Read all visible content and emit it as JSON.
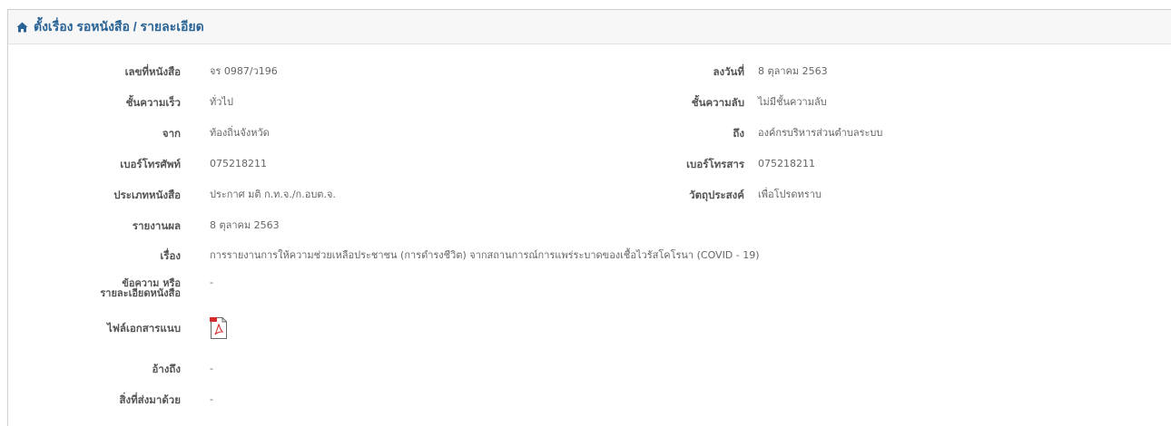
{
  "header": {
    "icon": "home-icon",
    "title": "ตั้งเรื่อง รอหนังสือ / รายละเอียด",
    "title_color": "#2a6496"
  },
  "fields": {
    "doc_number": {
      "label": "เลขที่หนังสือ",
      "value": "จร 0987/ว196"
    },
    "date": {
      "label": "ลงวันที่",
      "value": "8 ตุลาคม 2563"
    },
    "urgency": {
      "label": "ชั้นความเร็ว",
      "value": "ทั่วไป"
    },
    "secrecy": {
      "label": "ชั้นความลับ",
      "value": "ไม่มีชั้นความลับ"
    },
    "from": {
      "label": "จาก",
      "value": "ท้องถิ่นจังหวัด"
    },
    "to": {
      "label": "ถึง",
      "value": "องค์กรบริหารส่วนตำบลระบบ"
    },
    "phone": {
      "label": "เบอร์โทรศัพท์",
      "value": "075218211"
    },
    "fax": {
      "label": "เบอร์โทรสาร",
      "value": "075218211"
    },
    "doc_type": {
      "label": "ประเภทหนังสือ",
      "value": "ประกาศ มติ ก.ท.จ./ก.อบต.จ."
    },
    "purpose": {
      "label": "วัตถุประสงค์",
      "value": "เพื่อโปรดทราบ"
    },
    "report": {
      "label": "รายงานผล",
      "value": "8 ตุลาคม 2563"
    },
    "subject": {
      "label": "เรื่อง",
      "value": "การรายงานการให้ความช่วยเหลือประชาชน (การดำรงชีวิต) จากสถานการณ์การแพร่ระบาดของเชื้อไวรัสโคโรนา (COVID - 19)"
    },
    "details": {
      "label_line1": "ข้อความ หรือ",
      "label_line2": "รายละเอียดหนังสือ",
      "value": "-"
    },
    "attachment": {
      "label": "ไฟล์เอกสารแนบ",
      "icon": "pdf-file-icon"
    },
    "reference": {
      "label": "อ้างถึง",
      "value": "-"
    },
    "enclosure": {
      "label": "สิ่งที่ส่งมาด้วย",
      "value": "-"
    }
  }
}
